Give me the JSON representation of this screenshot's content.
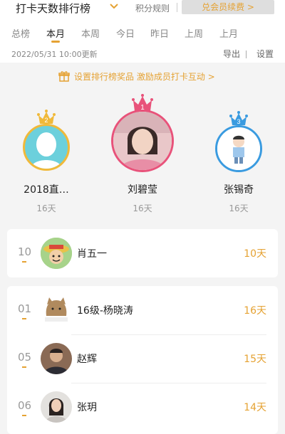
{
  "header": {
    "title": "打卡天数排行榜",
    "rules_label": "积分规则",
    "renew_label": "兑会员续费 >"
  },
  "tabs": [
    {
      "label": "总榜",
      "active": false
    },
    {
      "label": "本月",
      "active": true
    },
    {
      "label": "本周",
      "active": false
    },
    {
      "label": "今日",
      "active": false
    },
    {
      "label": "昨日",
      "active": false
    },
    {
      "label": "上周",
      "active": false
    },
    {
      "label": "上月",
      "active": false
    }
  ],
  "info": {
    "update_time": "2022/05/31 10:00更新",
    "export_label": "导出",
    "separator": "|",
    "settings_label": "设置"
  },
  "prize_banner": {
    "text": "设置排行榜奖品 激励成员打卡互动 >"
  },
  "podium": [
    {
      "rank": "1",
      "name": "刘碧莹",
      "days": "16天",
      "crown_color": "#e8527a"
    },
    {
      "rank": "2",
      "name": "2018直…",
      "days": "16天",
      "crown_color": "#f0b93a"
    },
    {
      "rank": "3",
      "name": "张锡奇",
      "days": "16天",
      "crown_color": "#3a9be0"
    }
  ],
  "my_rank": {
    "rank": "10",
    "name": "肖五一",
    "days": "10天"
  },
  "list": [
    {
      "rank": "01",
      "name": "16级-杨晓涛",
      "days": "16天"
    },
    {
      "rank": "05",
      "name": "赵辉",
      "days": "15天"
    },
    {
      "rank": "06",
      "name": "张玥",
      "days": "14天"
    }
  ],
  "colors": {
    "accent": "#e5a233",
    "gold": "#f0b93a",
    "pink": "#e8527a",
    "blue": "#3a9be0"
  }
}
